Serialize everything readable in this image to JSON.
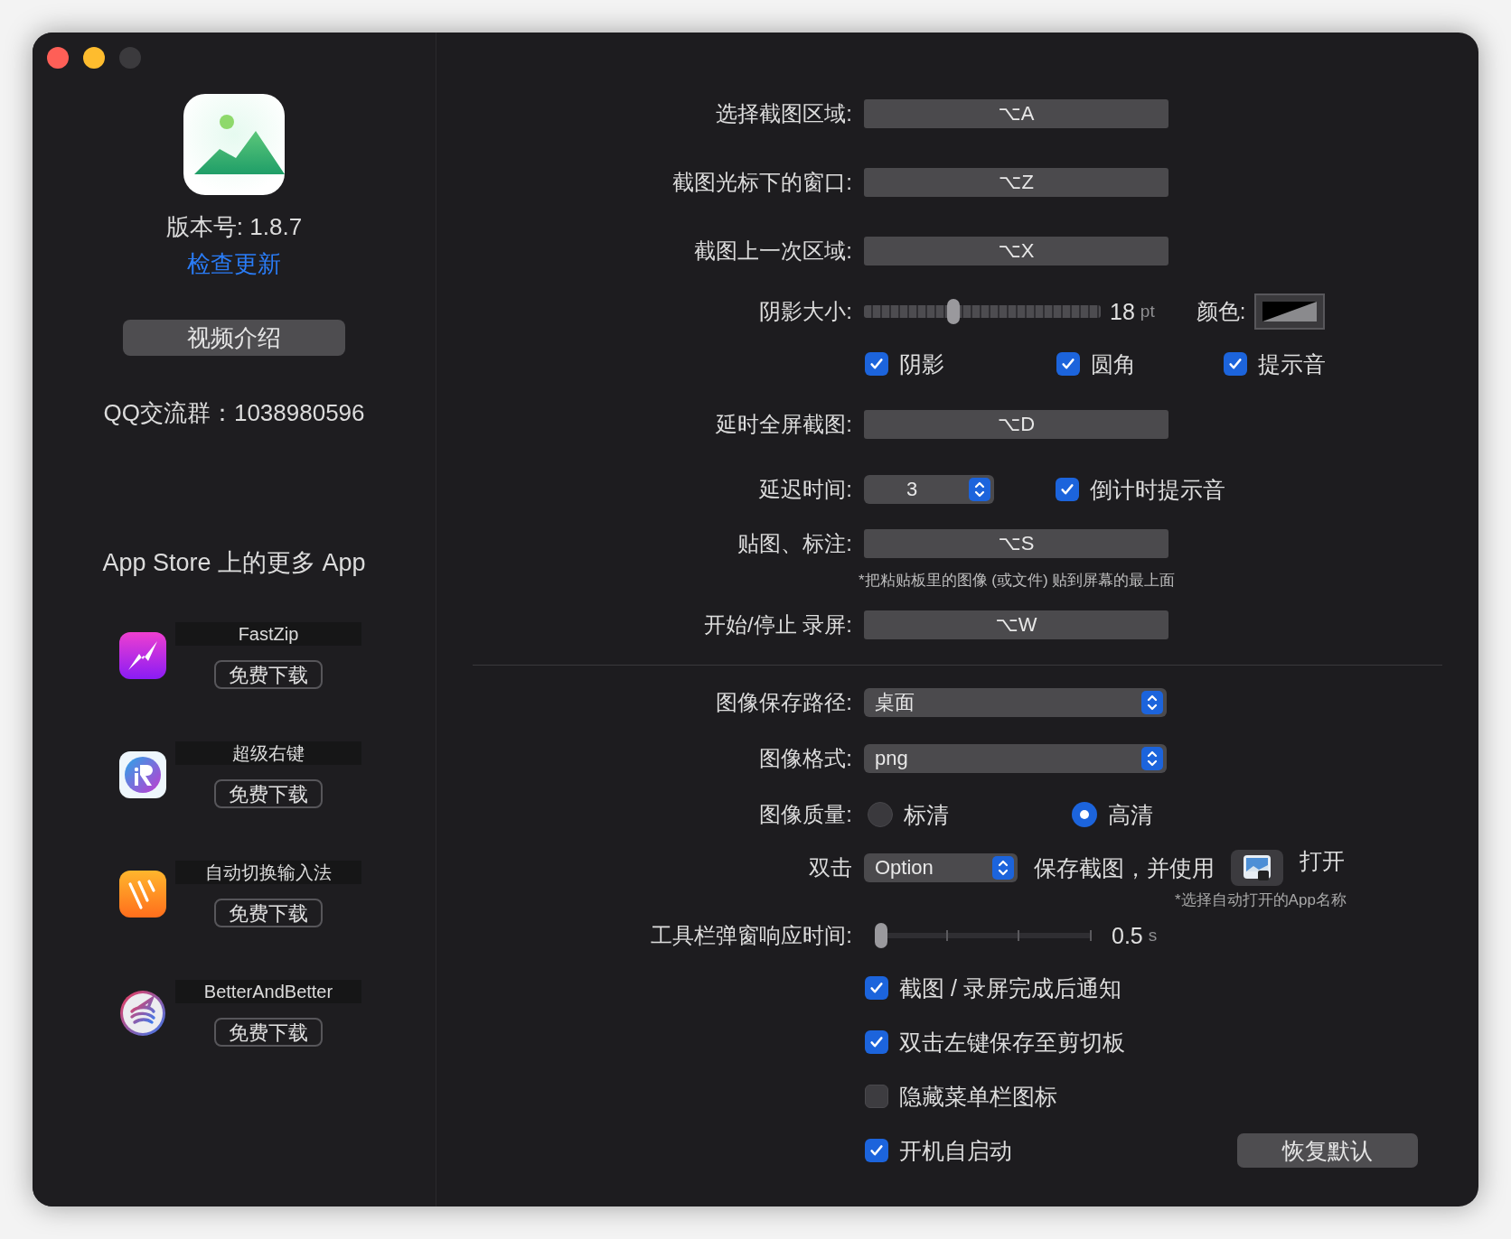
{
  "sidebar": {
    "version": "版本号: 1.8.7",
    "check_update": "检查更新",
    "video_button": "视频介绍",
    "qq_group": "QQ交流群：1038980596",
    "more_apps_title": "App Store 上的更多 App",
    "apps": [
      {
        "kind": "bolt",
        "name": "FastZip",
        "button": "免费下载"
      },
      {
        "kind": "letter",
        "name": "超级右键",
        "button": "免费下载"
      },
      {
        "kind": "strokes",
        "name": "自动切换输入法",
        "button": "免费下载"
      },
      {
        "kind": "swirl",
        "name": "BetterAndBetter",
        "button": "免费下载"
      }
    ]
  },
  "sections": [
    {
      "rows": [
        {
          "kind": "shortcut",
          "label": "选择截图区域:",
          "value": "⌥A"
        },
        {
          "kind": "shortcut",
          "label": "截图光标下的窗口:",
          "value": "⌥Z"
        },
        {
          "kind": "shortcut",
          "label": "截图上一次区域:",
          "value": "⌥X"
        },
        {
          "kind": "slider",
          "label": "阴影大小:",
          "level": 0.37,
          "reading": "18",
          "unit": "pt",
          "color_label": "颜色:"
        },
        {
          "kind": "checks",
          "items": [
            {
              "label": "阴影",
              "checked": true
            },
            {
              "label": "圆角",
              "checked": true
            },
            {
              "label": "提示音",
              "checked": true
            }
          ]
        },
        {
          "kind": "shortcut",
          "label": "延时全屏截图:",
          "value": "⌥D"
        },
        {
          "kind": "stepper",
          "label": "延迟时间:",
          "value": "3",
          "check": {
            "label": "倒计时提示音",
            "checked": true
          }
        },
        {
          "kind": "shortcut",
          "label": "贴图、标注:",
          "value": "⌥S",
          "note": "*把粘贴板里的图像 (或文件) 贴到屏幕的最上面"
        },
        {
          "kind": "shortcut",
          "label": "开始/停止 录屏:",
          "value": "⌥W"
        }
      ]
    },
    {
      "rows": [
        {
          "kind": "popup",
          "label": "图像保存路径:",
          "value": "桌面"
        },
        {
          "kind": "popup",
          "label": "图像格式:",
          "value": "png"
        },
        {
          "kind": "radio",
          "label": "图像质量:",
          "options": [
            {
              "label": "标清",
              "selected": false
            },
            {
              "label": "高清",
              "selected": true
            }
          ]
        },
        {
          "kind": "doubleclick",
          "label": "双击",
          "value": "Option",
          "text": "保存截图，并使用",
          "action": "打开",
          "note": "*选择自动打开的App名称"
        },
        {
          "kind": "ticks",
          "label": "工具栏弹窗响应时间:",
          "level": 0,
          "reading": "0.5",
          "unit": "s"
        },
        {
          "kind": "check",
          "label": "截图 / 录屏完成后通知",
          "checked": true
        },
        {
          "kind": "check",
          "label": "双击左键保存至剪切板",
          "checked": true
        },
        {
          "kind": "check",
          "label": "隐藏菜单栏图标",
          "checked": false
        },
        {
          "kind": "check",
          "label": "开机自启动",
          "checked": true
        }
      ]
    }
  ],
  "reset_button": "恢复默认"
}
